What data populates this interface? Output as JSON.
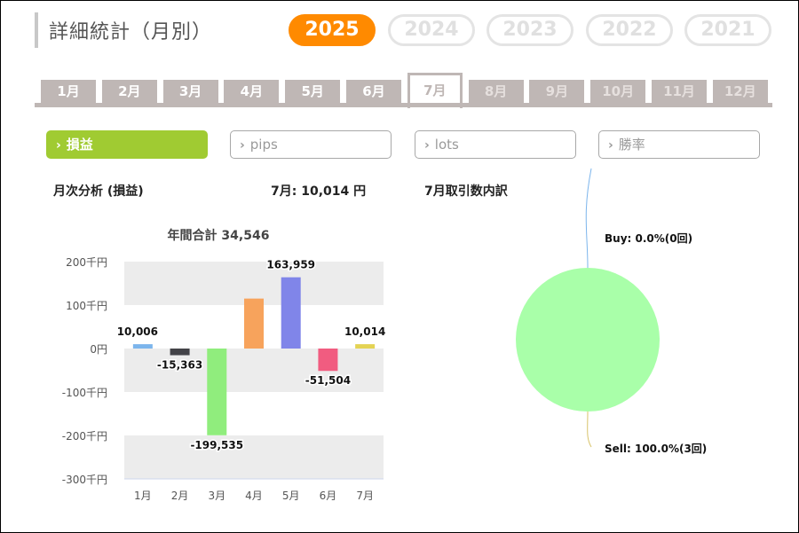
{
  "header": {
    "title": "詳細統計（月別）"
  },
  "years": [
    {
      "label": "2025",
      "active": true
    },
    {
      "label": "2024",
      "active": false
    },
    {
      "label": "2023",
      "active": false
    },
    {
      "label": "2022",
      "active": false
    },
    {
      "label": "2021",
      "active": false
    }
  ],
  "months": [
    {
      "label": "1月",
      "state": "enabled"
    },
    {
      "label": "2月",
      "state": "enabled"
    },
    {
      "label": "3月",
      "state": "enabled"
    },
    {
      "label": "4月",
      "state": "enabled"
    },
    {
      "label": "5月",
      "state": "enabled"
    },
    {
      "label": "6月",
      "state": "enabled"
    },
    {
      "label": "7月",
      "state": "active"
    },
    {
      "label": "8月",
      "state": "disabled"
    },
    {
      "label": "9月",
      "state": "disabled"
    },
    {
      "label": "10月",
      "state": "disabled"
    },
    {
      "label": "11月",
      "state": "disabled"
    },
    {
      "label": "12月",
      "state": "disabled"
    }
  ],
  "metrics": [
    {
      "label": "損益",
      "active": true
    },
    {
      "label": "pips",
      "active": false
    },
    {
      "label": "lots",
      "active": false
    },
    {
      "label": "勝率",
      "active": false
    }
  ],
  "summary": {
    "monthly_heading": "月次分析 (損益)",
    "current_month_value": "7月:  10,014 円",
    "breakdown_heading": "7月取引数内訳"
  },
  "colors": {
    "accent": "#ff8a00",
    "active_metric": "#a0cb32",
    "tab": "#bfb7b5"
  },
  "chart_data": [
    {
      "type": "bar",
      "title": "年間合計 34,546",
      "categories": [
        "1月",
        "2月",
        "3月",
        "4月",
        "5月",
        "6月",
        "7月"
      ],
      "values": [
        10006,
        -15363,
        -199535,
        115000,
        163959,
        -51504,
        10014
      ],
      "data_labels": [
        "10,006",
        "-15,363",
        "-199,535",
        "",
        "163,959",
        "-51,504",
        "10,014"
      ],
      "bar_colors": [
        "#7cb5ec",
        "#434348",
        "#90ed7d",
        "#f7a35c",
        "#8085e9",
        "#f15c80",
        "#e4d354"
      ],
      "ylim": [
        -300000,
        200000
      ],
      "yticks": [
        200000,
        100000,
        0,
        -100000,
        -200000,
        -300000
      ],
      "ytick_labels": [
        "200千円",
        "100千円",
        "0円",
        "-100千円",
        "-200千円",
        "-300千円"
      ],
      "grid": "alternating bands"
    },
    {
      "type": "pie",
      "slices": [
        {
          "name": "Buy",
          "value": 0,
          "label": "Buy: 0.0%(0回)",
          "color": "#7cb5ec"
        },
        {
          "name": "Sell",
          "value": 100,
          "label": "Sell: 100.0%(3回)",
          "color": "#a9ffa9"
        }
      ]
    }
  ]
}
